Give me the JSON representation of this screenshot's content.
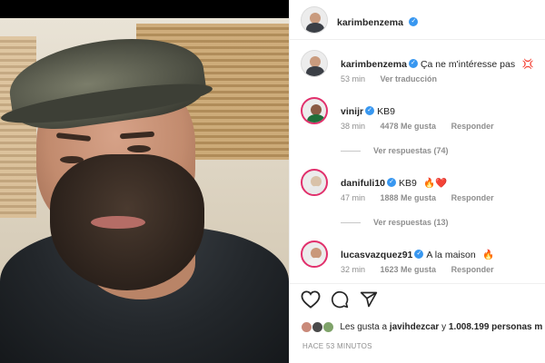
{
  "post": {
    "author": "karimbenzema",
    "caption": "Ça ne m'intéresse pas",
    "caption_emoji": "💢",
    "caption_time": "53 min",
    "translation_label": "Ver traducción"
  },
  "comments": [
    {
      "username": "vinijr",
      "text": "KB9",
      "time": "38 min",
      "likes": "4478 Me gusta",
      "reply_label": "Responder",
      "view_replies": "Ver respuestas (74)"
    },
    {
      "username": "danifuli10",
      "text": "KB9",
      "emojis": "🔥❤️",
      "time": "47 min",
      "likes": "1888 Me gusta",
      "reply_label": "Responder",
      "view_replies": "Ver respuestas (13)"
    },
    {
      "username": "lucasvazquez91",
      "text": "A la maison",
      "emojis": "🔥",
      "time": "32 min",
      "likes": "1623 Me gusta",
      "reply_label": "Responder"
    }
  ],
  "likes": {
    "prefix": "Les gusta a",
    "user": "javihdezcar",
    "suffix": "y",
    "count": "1.008.199 personas m"
  },
  "timestamp": "HACE 53 MINUTOS",
  "colors": {
    "verified": "#3897f0",
    "muted": "#8e8e8e",
    "text": "#262626",
    "story_ring": "#e1306c"
  },
  "icons": {
    "like": "heart-icon",
    "comment": "comment-icon",
    "share": "paper-plane-icon"
  }
}
